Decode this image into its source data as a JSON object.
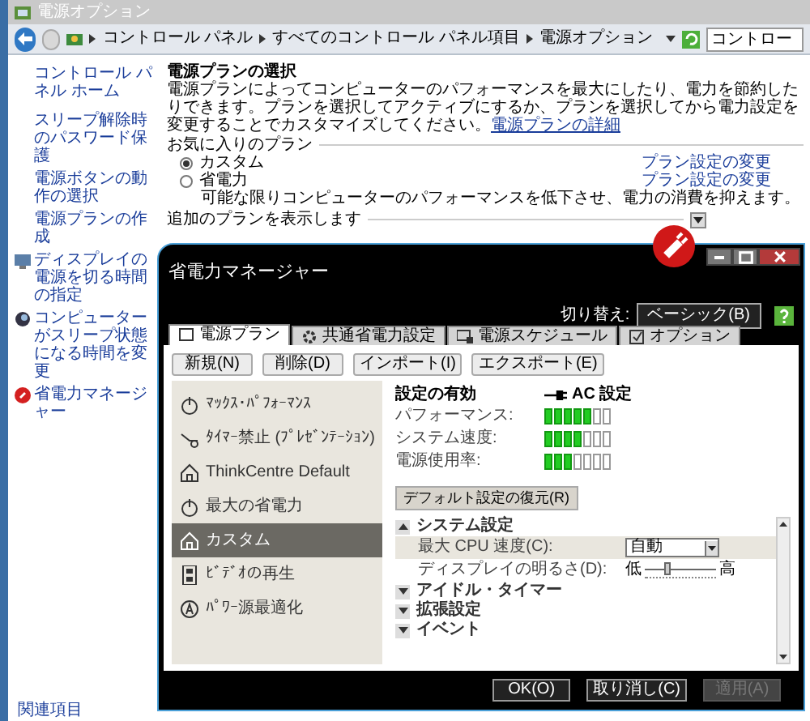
{
  "window": {
    "title": "電源オプション"
  },
  "address_bar": {
    "breadcrumbs": [
      "コントロール パネル",
      "すべてのコントロール パネル項目",
      "電源オプション"
    ],
    "search_text": "コントロー"
  },
  "sidebar": {
    "home": "コントロール パネル ホーム",
    "links": [
      {
        "label": "スリープ解除時のパスワード保護"
      },
      {
        "label": "電源ボタンの動作の選択"
      },
      {
        "label": "電源プランの作成"
      },
      {
        "label": "ディスプレイの電源を切る時間の指定"
      },
      {
        "label": "コンピューターがスリープ状態になる時間を変更"
      },
      {
        "label": "省電力マネージャー"
      }
    ],
    "related": "関連項目"
  },
  "main": {
    "heading": "電源プランの選択",
    "description": "電源プランによってコンピューターのパフォーマンスを最大にしたり、電力を節約したりできます。プランを選択してアクティブにするか、プランを選択してから電力設定を変更することでカスタマイズしてください。",
    "description_link": "電源プランの詳細",
    "favorites_label": "お気に入りのプラン",
    "plans": [
      {
        "name": "カスタム",
        "selected": true,
        "link": "プラン設定の変更"
      },
      {
        "name": "省電力",
        "selected": false,
        "link": "プラン設定の変更",
        "description": "可能な限りコンピューターのパフォーマンスを低下させ、電力の消費を抑えます。"
      }
    ],
    "more_plans": "追加のプランを表示します"
  },
  "power_manager": {
    "title": "省電力マネージャー",
    "switch_label": "切り替え:",
    "switch_button": "ベーシック(B)",
    "tabs": [
      {
        "label": "電源プラン",
        "selected": true
      },
      {
        "label": "共通省電力設定",
        "selected": false
      },
      {
        "label": "電源スケジュール",
        "selected": false
      },
      {
        "label": "オプション",
        "selected": false
      }
    ],
    "toolbar": [
      "新規(N)",
      "削除(D)",
      "インポート(I)",
      "エクスポート(E)"
    ],
    "plans": [
      {
        "label": "ﾏｯｸｽ･ﾊﾟﾌｫｰﾏﾝｽ",
        "selected": false
      },
      {
        "label": "ﾀｲﾏｰ禁止 (ﾌﾟﾚｾﾞﾝﾃｰｼｮﾝ)",
        "selected": false
      },
      {
        "label": "ThinkCentre Default",
        "selected": false
      },
      {
        "label": "最大の省電力",
        "selected": false
      },
      {
        "label": "カスタム",
        "selected": true
      },
      {
        "label": "ﾋﾞﾃﾞｵの再生",
        "selected": false
      },
      {
        "label": "ﾊﾟﾜｰ源最適化",
        "selected": false
      }
    ],
    "effective_label": "設定の有効",
    "ac_label": "AC 設定",
    "meters": [
      {
        "label": "パフォーマンス:",
        "level": 0.714
      },
      {
        "label": "システム速度:",
        "level": 0.571
      },
      {
        "label": "電源使用率:",
        "level": 0.429
      }
    ],
    "restore_button": "デフォルト設定の復元(R)",
    "sections": [
      {
        "title": "システム設定",
        "expanded": true,
        "settings": [
          {
            "kind": "dropdown",
            "label": "最大 CPU 速度(C):",
            "value": "自動",
            "selected": true
          },
          {
            "kind": "slider",
            "label": "ディスプレイの明るさ(D):",
            "low": "低",
            "high": "高",
            "level": 0.3,
            "selected": false
          }
        ]
      },
      {
        "title": "アイドル・タイマー",
        "expanded": false
      },
      {
        "title": "拡張設定",
        "expanded": false
      },
      {
        "title": "イベント",
        "expanded": false
      }
    ],
    "footer_buttons": [
      {
        "label": "OK(O)",
        "disabled": false
      },
      {
        "label": "取り消し(C)",
        "disabled": false
      },
      {
        "label": "適用(A)",
        "disabled": true
      }
    ]
  }
}
